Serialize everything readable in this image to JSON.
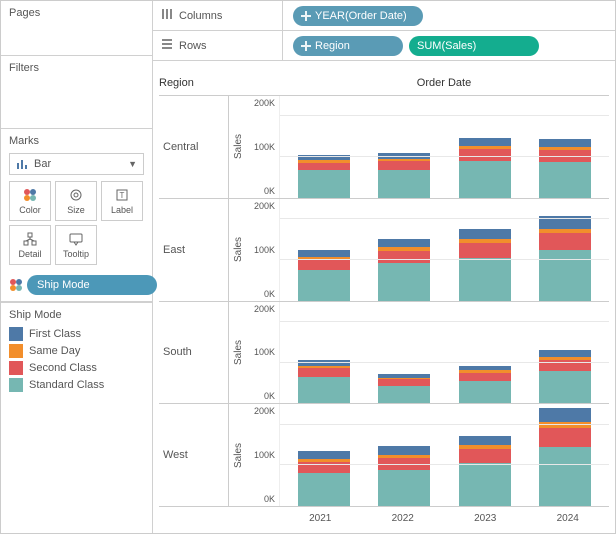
{
  "panels": {
    "pages": "Pages",
    "filters": "Filters",
    "marks": "Marks",
    "marksType": "Bar",
    "markButtons": {
      "color": "Color",
      "size": "Size",
      "label": "Label",
      "detail": "Detail",
      "tooltip": "Tooltip"
    },
    "shipModePill": "Ship Mode"
  },
  "legend": {
    "title": "Ship Mode",
    "items": [
      {
        "label": "First Class",
        "color": "#4e79a7"
      },
      {
        "label": "Same Day",
        "color": "#f28e2b"
      },
      {
        "label": "Second Class",
        "color": "#e15759"
      },
      {
        "label": "Standard Class",
        "color": "#76b7b2"
      }
    ]
  },
  "shelves": {
    "columnsLabel": "Columns",
    "rowsLabel": "Rows",
    "columns": [
      {
        "label": "YEAR(Order Date)"
      }
    ],
    "rows": [
      {
        "label": "Region"
      },
      {
        "label": "SUM(Sales)"
      }
    ]
  },
  "viz_header": {
    "region": "Region",
    "date": "Order Date",
    "sales": "Sales"
  },
  "ticks": [
    "200K",
    "100K",
    "0K"
  ],
  "x_categories": [
    "2021",
    "2022",
    "2023",
    "2024"
  ],
  "chart_data": {
    "type": "bar",
    "stacked": true,
    "title": "",
    "xlabel": "Order Date",
    "ylabel": "Sales",
    "ylim": [
      0,
      250000
    ],
    "facets_row": [
      "Central",
      "East",
      "South",
      "West"
    ],
    "categories": [
      "2021",
      "2022",
      "2023",
      "2024"
    ],
    "series_names": [
      "Standard Class",
      "Second Class",
      "Same Day",
      "First Class"
    ],
    "series_colors": [
      "#76b7b2",
      "#e15759",
      "#f28e2b",
      "#4e79a7"
    ],
    "data": {
      "Central": [
        {
          "Standard Class": 70000,
          "Second Class": 20000,
          "Same Day": 6000,
          "First Class": 14000
        },
        {
          "Standard Class": 72000,
          "Second Class": 22000,
          "Same Day": 6000,
          "First Class": 15000
        },
        {
          "Standard Class": 95000,
          "Second Class": 30000,
          "Same Day": 8000,
          "First Class": 20000
        },
        {
          "Standard Class": 92000,
          "Second Class": 30000,
          "Same Day": 8000,
          "First Class": 20000
        }
      ],
      "East": [
        {
          "Standard Class": 78000,
          "Second Class": 26000,
          "Same Day": 8000,
          "First Class": 18000
        },
        {
          "Standard Class": 95000,
          "Second Class": 32000,
          "Same Day": 9000,
          "First Class": 22000
        },
        {
          "Standard Class": 110000,
          "Second Class": 38000,
          "Same Day": 10000,
          "First Class": 26000
        },
        {
          "Standard Class": 130000,
          "Second Class": 42000,
          "Same Day": 12000,
          "First Class": 32000
        }
      ],
      "South": [
        {
          "Standard Class": 68000,
          "Second Class": 22000,
          "Same Day": 6000,
          "First Class": 14000
        },
        {
          "Standard Class": 45000,
          "Second Class": 16000,
          "Same Day": 4000,
          "First Class": 10000
        },
        {
          "Standard Class": 58000,
          "Second Class": 20000,
          "Same Day": 6000,
          "First Class": 12000
        },
        {
          "Standard Class": 82000,
          "Second Class": 28000,
          "Same Day": 8000,
          "First Class": 18000
        }
      ],
      "West": [
        {
          "Standard Class": 85000,
          "Second Class": 28000,
          "Same Day": 8000,
          "First Class": 20000
        },
        {
          "Standard Class": 92000,
          "Second Class": 30000,
          "Same Day": 9000,
          "First Class": 22000
        },
        {
          "Standard Class": 110000,
          "Second Class": 35000,
          "Same Day": 10000,
          "First Class": 25000
        },
        {
          "Standard Class": 150000,
          "Second Class": 50000,
          "Same Day": 14000,
          "First Class": 36000
        }
      ]
    }
  }
}
